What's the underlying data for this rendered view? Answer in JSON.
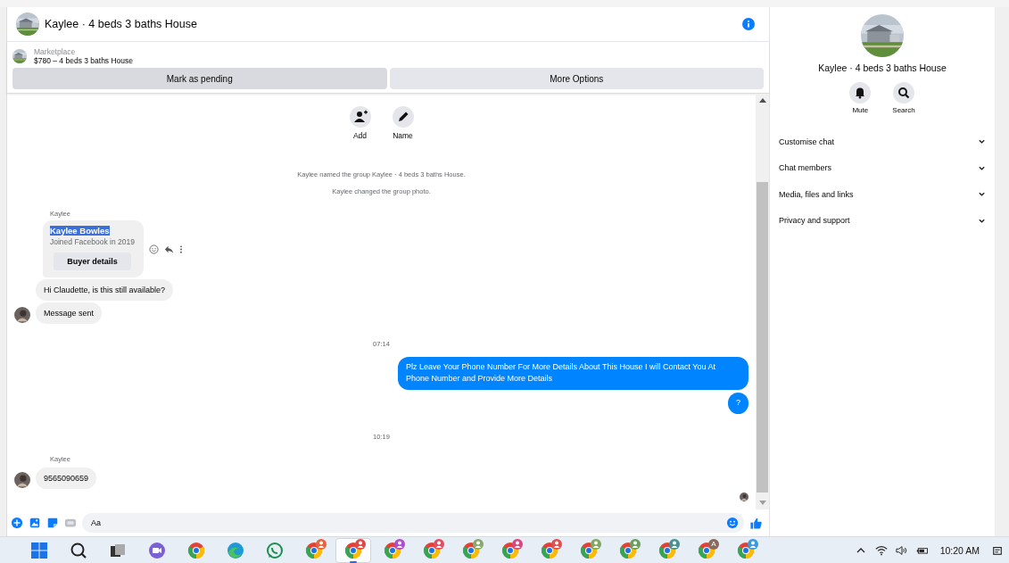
{
  "header": {
    "title": "Kaylee · 4 beds 3 baths House"
  },
  "listing": {
    "label": "Marketplace",
    "title": "$780 – 4 beds 3 baths House",
    "buttons": [
      {
        "label": "Mark as pending",
        "highlighted": true
      },
      {
        "label": "More Options",
        "highlighted": false
      }
    ]
  },
  "group_actions": [
    {
      "label": "Add",
      "kind": "add"
    },
    {
      "label": "Name",
      "kind": "edit"
    }
  ],
  "messages": [
    {
      "kind": "event",
      "text": "Kaylee named the group Kaylee · 4 beds 3 baths House."
    },
    {
      "kind": "event",
      "text": "Kaylee changed the group photo."
    },
    {
      "kind": "sender",
      "text": "Kaylee"
    },
    {
      "kind": "card",
      "title": "Kaylee Bowles",
      "title_selected": true,
      "subtitle": "Joined Facebook in 2019",
      "button": "Buyer details"
    },
    {
      "kind": "incoming",
      "text": "Hi Claudette, is this still available?",
      "avatar": false
    },
    {
      "kind": "incoming",
      "text": "Message sent",
      "avatar": true
    },
    {
      "kind": "time",
      "text": "07:14"
    },
    {
      "kind": "outgoing",
      "text": "Plz Leave Your Phone Number For More Details About This House I will Contact You At Phone Number and Provide More Details"
    },
    {
      "kind": "outgoing",
      "text": "?"
    },
    {
      "kind": "time",
      "text": "10:19"
    },
    {
      "kind": "sender",
      "text": "Kaylee"
    },
    {
      "kind": "incoming",
      "text": "9565090659",
      "avatar": true
    }
  ],
  "composer": {
    "placeholder": "Aa"
  },
  "side_panel": {
    "title": "Kaylee · 4 beds 3 baths House",
    "buttons": [
      {
        "label": "Mute",
        "kind": "bell"
      },
      {
        "label": "Search",
        "kind": "search"
      }
    ],
    "sections": [
      {
        "label": "Customise chat",
        "expanded": false
      },
      {
        "label": "Chat members",
        "expanded": false
      },
      {
        "label": "Media, files and links",
        "expanded": false
      },
      {
        "label": "Privacy and support",
        "expanded": false
      }
    ]
  },
  "taskbar": {
    "apps": [
      {
        "kind": "start",
        "selected": false
      },
      {
        "kind": "search",
        "selected": false
      },
      {
        "kind": "taskview",
        "selected": false
      },
      {
        "kind": "meet",
        "selected": false
      },
      {
        "kind": "chrome",
        "selected": false
      },
      {
        "kind": "edge",
        "selected": false
      },
      {
        "kind": "whatsapp",
        "selected": false
      },
      {
        "kind": "profile",
        "color": "#e8623c",
        "selected": false
      },
      {
        "kind": "profile",
        "color": "#e04848",
        "selected": true
      },
      {
        "kind": "profile",
        "color": "#b04ad0",
        "selected": false
      },
      {
        "kind": "profile",
        "color": "#e05060",
        "selected": false
      },
      {
        "kind": "profile",
        "color": "#8aa870",
        "selected": false
      },
      {
        "kind": "profile",
        "color": "#d84880",
        "selected": false
      },
      {
        "kind": "profile",
        "color": "#e05050",
        "selected": false
      },
      {
        "kind": "profile",
        "color": "#80a860",
        "selected": false
      },
      {
        "kind": "profile",
        "color": "#6aa060",
        "selected": false
      },
      {
        "kind": "profile",
        "color": "#4a9090",
        "selected": false
      },
      {
        "kind": "letter",
        "letter": "A",
        "color": "#8a6a5a",
        "selected": false
      },
      {
        "kind": "profile",
        "color": "#3a9ae0",
        "selected": false
      }
    ],
    "time": "10:20 AM"
  }
}
